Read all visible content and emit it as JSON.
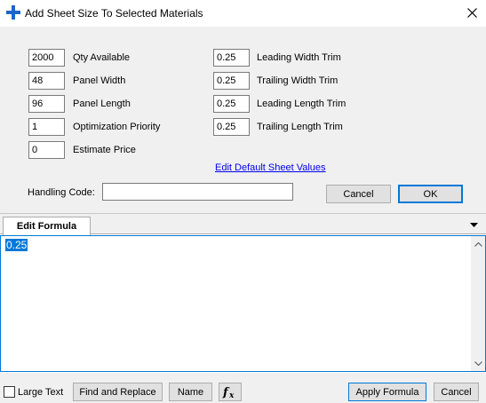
{
  "window": {
    "title": "Add Sheet Size To Selected Materials",
    "icon": "plus-icon",
    "close_icon": "close-icon"
  },
  "left_fields": [
    {
      "value": "2000",
      "label": "Qty Available"
    },
    {
      "value": "48",
      "label": "Panel Width"
    },
    {
      "value": "96",
      "label": "Panel Length"
    },
    {
      "value": "1",
      "label": "Optimization Priority"
    },
    {
      "value": "0",
      "label": "Estimate Price"
    }
  ],
  "right_fields": [
    {
      "value": "0.25",
      "label": "Leading Width Trim"
    },
    {
      "value": "0.25",
      "label": "Trailing Width Trim"
    },
    {
      "value": "0.25",
      "label": "Leading Length Trim"
    },
    {
      "value": "0.25",
      "label": "Trailing Length Trim"
    }
  ],
  "edit_defaults_link": "Edit Default Sheet Values",
  "handling_code": {
    "label": "Handling Code:",
    "value": ""
  },
  "dialog_buttons": {
    "cancel": "Cancel",
    "ok": "OK"
  },
  "tabs": [
    {
      "label": "Edit Formula"
    }
  ],
  "editor": {
    "text": "0.25"
  },
  "bottom": {
    "large_text_label": "Large Text",
    "find_replace": "Find and Replace",
    "name": "Name",
    "fx_icon": "function-icon",
    "apply_formula": "Apply Formula",
    "cancel": "Cancel"
  },
  "colors": {
    "accent": "#0078d7",
    "title_icon": "#1a66c9",
    "link": "#0000ee"
  }
}
